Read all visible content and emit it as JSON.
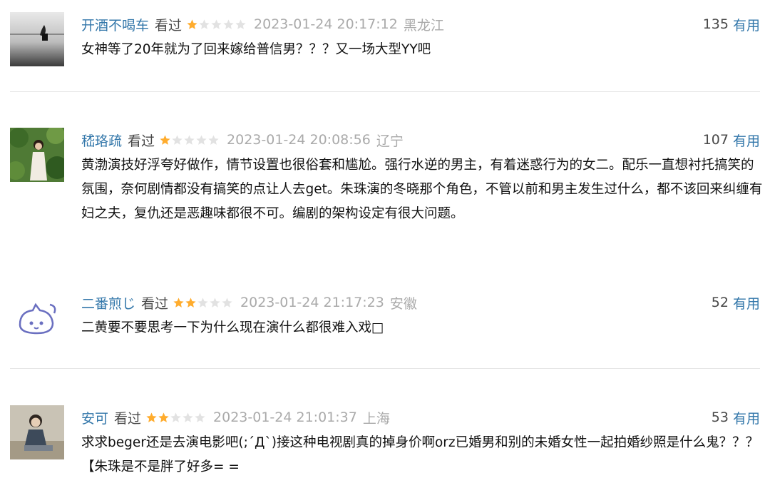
{
  "comments": [
    {
      "user": "开酒不喝车",
      "status": "看过",
      "rating": 1,
      "time": "2023-01-24 20:17:12",
      "location": "黑龙江",
      "votes": "135",
      "vote_label": "有用",
      "text": "女神等了20年就为了回来嫁给普信男？？？又一场大型YY吧",
      "avatar_icon": "silhouette-avatar-icon"
    },
    {
      "user": "嵇珞疏",
      "status": "看过",
      "rating": 1,
      "time": "2023-01-24 20:08:56",
      "location": "辽宁",
      "votes": "107",
      "vote_label": "有用",
      "text": "黄渤演技好浮夸好做作，情节设置也很俗套和尴尬。强行水逆的男主，有着迷惑行为的女二。配乐一直想衬托搞笑的氛围，奈何剧情都没有搞笑的点让人去get。朱珠演的冬晓那个角色，不管以前和男主发生过什么，都不该回来纠缠有妇之夫，复仇还是恶趣味都很不可。编剧的架构设定有很大问题。",
      "avatar_icon": "girl-in-garden-avatar-icon"
    },
    {
      "user": "二番煎じ",
      "status": "看过",
      "rating": 2,
      "time": "2023-01-24 21:17:23",
      "location": "安徽",
      "votes": "52",
      "vote_label": "有用",
      "text": "二黄要不要思考一下为什么现在演什么都很难入戏□",
      "avatar_icon": "cartoon-cat-avatar-icon"
    },
    {
      "user": "安可",
      "status": "看过",
      "rating": 2,
      "time": "2023-01-24 21:01:37",
      "location": "上海",
      "votes": "53",
      "vote_label": "有用",
      "text": "求求beger还是去演电影吧(;´Д`)接这种电视剧真的掉身价啊orz已婚男和别的未婚女性一起拍婚纱照是什么鬼？？？【朱珠是不是胖了好多= =",
      "avatar_icon": "seated-girl-avatar-icon"
    }
  ],
  "colors": {
    "link": "#3377aa",
    "star_filled": "#ffac2d",
    "star_empty": "#e2e2e2",
    "meta_gray": "#aaaaaa"
  }
}
